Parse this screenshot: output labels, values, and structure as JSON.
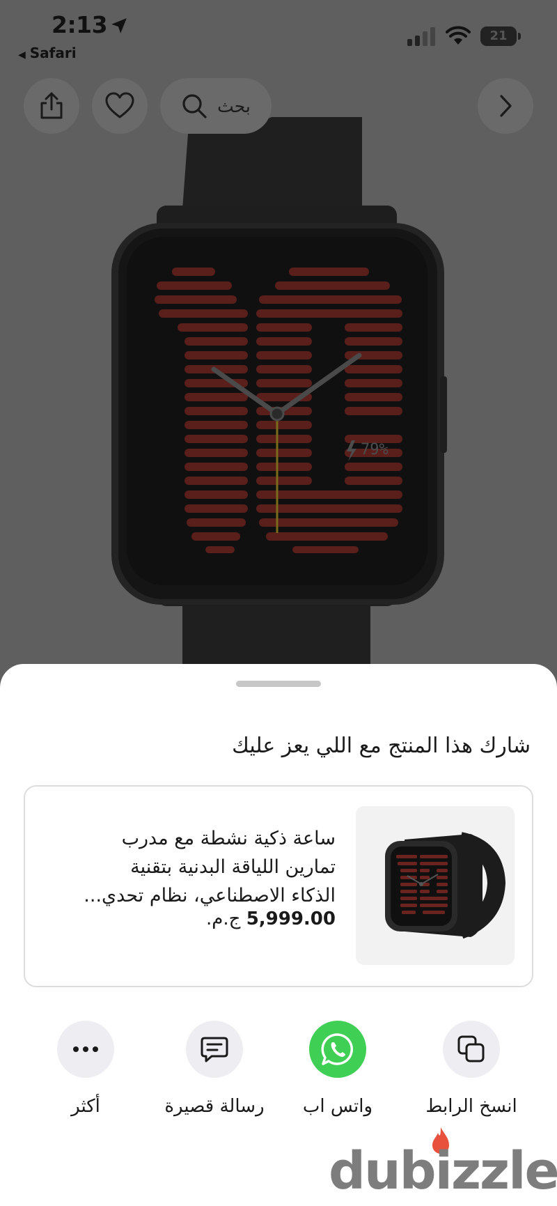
{
  "status_bar": {
    "time": "2:13",
    "back_app": "Safari",
    "battery": "21"
  },
  "top_actions": {
    "search_label": "بحث"
  },
  "watch_face": {
    "battery_text": "79%"
  },
  "share_sheet": {
    "title": "شارك هذا المنتج مع اللي يعز عليك",
    "product": {
      "line1": "ساعة ذكية نشطة مع مدرب",
      "line2": "تمارين اللياقة البدنية بتقنية",
      "line3": "الذكاء الاصطناعي، نظام تحدي...",
      "price": "5,999.00",
      "currency": "ج.م."
    },
    "options": [
      {
        "label": "انسخ الرابط",
        "icon": "copy-icon"
      },
      {
        "label": "واتس اب",
        "icon": "whatsapp-icon"
      },
      {
        "label": "رسالة قصيرة",
        "icon": "message-icon"
      },
      {
        "label": "أكثر",
        "icon": "more-icon"
      }
    ]
  },
  "watermark": {
    "text": "dubizzle"
  },
  "colors": {
    "whatsapp": "#3fcf55",
    "sheet_bg": "#ffffff",
    "overlay": "#5f5f5f"
  }
}
